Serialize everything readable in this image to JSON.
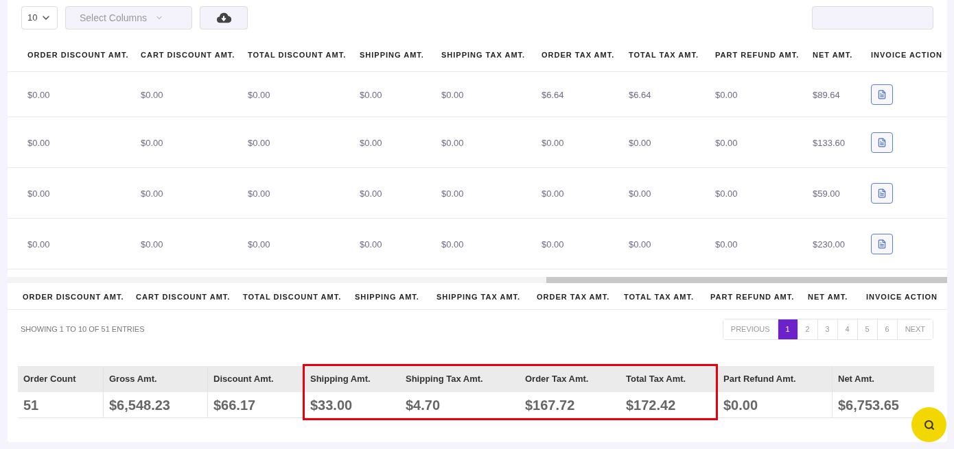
{
  "toolbar": {
    "page_size": "10",
    "column_picker": {
      "placeholder": "Select Columns"
    }
  },
  "table": {
    "columns": [
      "ORDER DISCOUNT AMT.",
      "CART DISCOUNT AMT.",
      "TOTAL DISCOUNT AMT.",
      "SHIPPING AMT.",
      "SHIPPING TAX AMT.",
      "ORDER TAX AMT.",
      "TOTAL TAX AMT.",
      "PART REFUND AMT.",
      "NET AMT.",
      "INVOICE ACTION"
    ],
    "rows": [
      {
        "cells": [
          "$0.00",
          "$0.00",
          "$0.00",
          "$0.00",
          "$0.00",
          "$6.64",
          "$6.64",
          "$0.00",
          "$89.64"
        ]
      },
      {
        "cells": [
          "$0.00",
          "$0.00",
          "$0.00",
          "$0.00",
          "$0.00",
          "$0.00",
          "$0.00",
          "$0.00",
          "$133.60"
        ]
      },
      {
        "cells": [
          "$0.00",
          "$0.00",
          "$0.00",
          "$0.00",
          "$0.00",
          "$0.00",
          "$0.00",
          "$0.00",
          "$59.00"
        ]
      },
      {
        "cells": [
          "$0.00",
          "$0.00",
          "$0.00",
          "$0.00",
          "$0.00",
          "$0.00",
          "$0.00",
          "$0.00",
          "$230.00"
        ]
      }
    ],
    "footer_columns": [
      "ORDER DISCOUNT AMT.",
      "CART DISCOUNT AMT.",
      "TOTAL DISCOUNT AMT.",
      "SHIPPING AMT.",
      "SHIPPING TAX AMT.",
      "ORDER TAX AMT.",
      "TOTAL TAX AMT.",
      "PART REFUND AMT.",
      "NET AMT.",
      "INVOICE ACTION"
    ]
  },
  "info": "SHOWING 1 TO 10 OF 51 ENTRIES",
  "pagination": [
    {
      "label": "PREVIOUS",
      "selected": false
    },
    {
      "label": "1",
      "selected": true
    },
    {
      "label": "2",
      "selected": false
    },
    {
      "label": "3",
      "selected": false
    },
    {
      "label": "4",
      "selected": false
    },
    {
      "label": "5",
      "selected": false
    },
    {
      "label": "6",
      "selected": false
    },
    {
      "label": "NEXT",
      "selected": false
    }
  ],
  "summary": [
    {
      "label": "Order Count",
      "value": "51",
      "highlighted": false
    },
    {
      "label": "Gross Amt.",
      "value": "$6,548.23",
      "highlighted": false
    },
    {
      "label": "Discount Amt.",
      "value": "$66.17",
      "highlighted": false
    },
    {
      "label": "Shipping Amt.",
      "value": "$33.00",
      "highlighted": true
    },
    {
      "label": "Shipping Tax Amt.",
      "value": "$4.70",
      "highlighted": true
    },
    {
      "label": "Order Tax Amt.",
      "value": "$167.72",
      "highlighted": true
    },
    {
      "label": "Total Tax Amt.",
      "value": "$172.42",
      "highlighted": true
    },
    {
      "label": "Part Refund Amt.",
      "value": "$0.00",
      "highlighted": false
    },
    {
      "label": "Net Amt.",
      "value": "$6,753.65",
      "highlighted": false
    }
  ]
}
